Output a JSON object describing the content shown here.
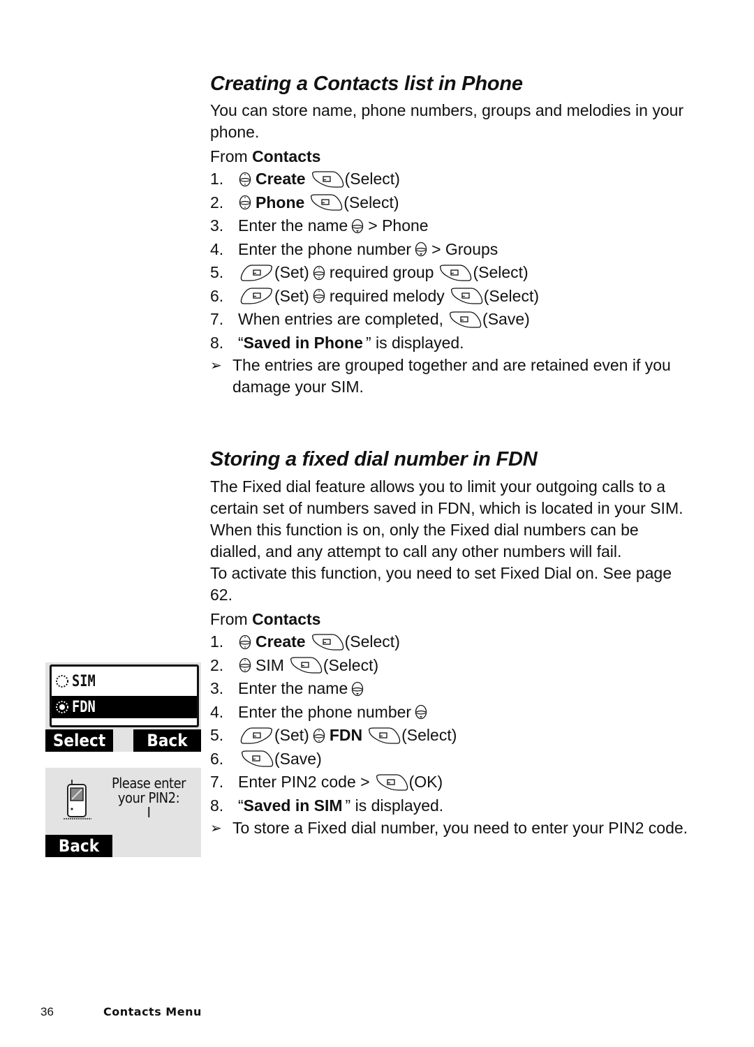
{
  "section1": {
    "title": "Creating a Contacts list in Phone",
    "intro": "You can store name, phone numbers, groups and melodies in your phone.",
    "from_prefix": "From",
    "from_menu": "Contacts",
    "steps": [
      {
        "num": "1.",
        "parts": [
          {
            "icon": "nav-scroll-icon"
          },
          {
            "bold": "Create"
          },
          {
            "icon": "right-softkey-icon"
          },
          {
            "text": "(Select)"
          }
        ]
      },
      {
        "num": "2.",
        "parts": [
          {
            "icon": "nav-scroll-icon"
          },
          {
            "bold": "Phone"
          },
          {
            "icon": "right-softkey-icon"
          },
          {
            "text": "(Select)"
          }
        ]
      },
      {
        "num": "3.",
        "parts": [
          {
            "text": "Enter the name"
          },
          {
            "icon": "nav-down-icon"
          },
          {
            "text": "> Phone"
          }
        ]
      },
      {
        "num": "4.",
        "parts": [
          {
            "text": "Enter the phone number"
          },
          {
            "icon": "nav-down-icon"
          },
          {
            "text": "> Groups"
          }
        ]
      },
      {
        "num": "5.",
        "parts": [
          {
            "icon": "left-softkey-icon"
          },
          {
            "text": "(Set)"
          },
          {
            "icon": "nav-scroll-icon"
          },
          {
            "text": "required group"
          },
          {
            "icon": "right-softkey-icon"
          },
          {
            "text": "(Select)"
          }
        ]
      },
      {
        "num": "6.",
        "parts": [
          {
            "icon": "left-softkey-icon"
          },
          {
            "text": "(Set)"
          },
          {
            "icon": "nav-scroll-icon"
          },
          {
            "text": "required melody"
          },
          {
            "icon": "right-softkey-icon"
          },
          {
            "text": "(Select)"
          }
        ]
      },
      {
        "num": "7.",
        "parts": [
          {
            "text": "When entries are completed,"
          },
          {
            "icon": "right-softkey-icon"
          },
          {
            "text": "(Save)"
          }
        ]
      },
      {
        "num": "8.",
        "parts": [
          {
            "text": "“"
          },
          {
            "bold": "Saved in Phone"
          },
          {
            "text": "” is displayed."
          }
        ]
      }
    ],
    "note": "The entries are grouped together and are retained even if you damage your SIM."
  },
  "section2": {
    "title": "Storing a fixed dial number in FDN",
    "intro": "The Fixed dial feature allows you to limit your outgoing calls to a certain set of numbers saved in FDN, which is located in your SIM. When this function is on, only the Fixed dial numbers can be dialled, and any attempt to call any other numbers will fail.",
    "activate": "To activate this function, you need to set Fixed Dial on. See page 62.",
    "from_prefix": "From",
    "from_menu": "Contacts",
    "steps": [
      {
        "num": "1.",
        "parts": [
          {
            "icon": "nav-scroll-icon"
          },
          {
            "bold": "Create"
          },
          {
            "icon": "right-softkey-icon"
          },
          {
            "text": "(Select)"
          }
        ]
      },
      {
        "num": "2.",
        "parts": [
          {
            "icon": "nav-scroll-icon"
          },
          {
            "text": "SIM"
          },
          {
            "icon": "right-softkey-icon"
          },
          {
            "text": "(Select)"
          }
        ]
      },
      {
        "num": "3.",
        "parts": [
          {
            "text": "Enter the name"
          },
          {
            "icon": "nav-down-icon"
          }
        ]
      },
      {
        "num": "4.",
        "parts": [
          {
            "text": "Enter the phone number"
          },
          {
            "icon": "nav-down-icon"
          }
        ]
      },
      {
        "num": "5.",
        "parts": [
          {
            "icon": "left-softkey-icon"
          },
          {
            "text": "(Set)"
          },
          {
            "icon": "nav-scroll-icon"
          },
          {
            "bold": "FDN"
          },
          {
            "icon": "right-softkey-icon"
          },
          {
            "text": "(Select)"
          }
        ]
      },
      {
        "num": "6.",
        "parts": [
          {
            "icon": "right-softkey-icon"
          },
          {
            "text": "(Save)"
          }
        ]
      },
      {
        "num": "7.",
        "parts": [
          {
            "text": "Enter PIN2 code >"
          },
          {
            "icon": "right-softkey-icon"
          },
          {
            "text": "(OK)"
          }
        ]
      },
      {
        "num": "8.",
        "parts": [
          {
            "text": "“"
          },
          {
            "bold": "Saved in SIM"
          },
          {
            "text": "” is displayed."
          }
        ]
      }
    ],
    "note": "To store a Fixed dial number, you need to enter your PIN2 code."
  },
  "screen1": {
    "options": [
      {
        "label": "SIM",
        "selected": false
      },
      {
        "label": "FDN",
        "selected": true
      }
    ],
    "left_softkey": "Select",
    "right_softkey": "Back"
  },
  "screen2": {
    "prompt_line1": "Please enter",
    "prompt_line2": "your PIN2:",
    "cursor": "I",
    "left_softkey": "Back"
  },
  "footer": {
    "page_number": "36",
    "section": "Contacts Menu"
  },
  "note_arrow": "➢"
}
